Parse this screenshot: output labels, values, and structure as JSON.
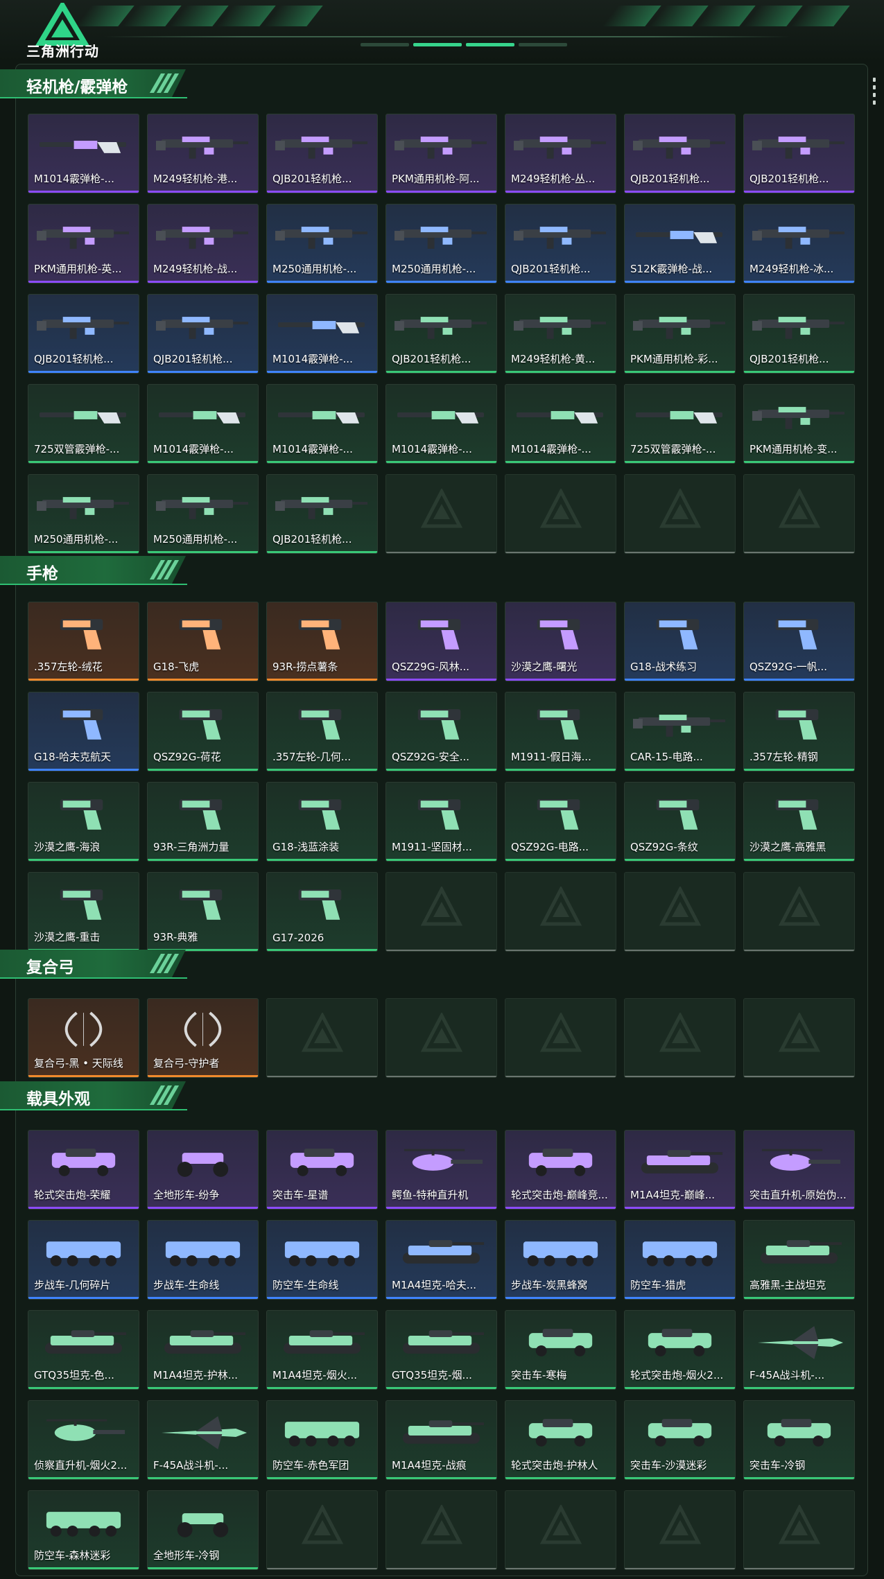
{
  "header": {
    "logo_text": "三角洲行动"
  },
  "colors": {
    "accent": "#37d58c",
    "purple": "#8c4bff",
    "blue": "#3f83ff",
    "green": "#39c877",
    "orange": "#f08a2c"
  },
  "sections": [
    {
      "title": "轻机枪/霰弹枪",
      "items": [
        {
          "name": "M1014霰弹枪-...",
          "rarity": "purple",
          "kind": "shotgun"
        },
        {
          "name": "M249轻机枪-港...",
          "rarity": "purple",
          "kind": "mg"
        },
        {
          "name": "QJB201轻机枪...",
          "rarity": "purple",
          "kind": "mg"
        },
        {
          "name": "PKM通用机枪-阿...",
          "rarity": "purple",
          "kind": "mg"
        },
        {
          "name": "M249轻机枪-丛...",
          "rarity": "purple",
          "kind": "mg"
        },
        {
          "name": "QJB201轻机枪...",
          "rarity": "purple",
          "kind": "mg"
        },
        {
          "name": "QJB201轻机枪...",
          "rarity": "purple",
          "kind": "mg"
        },
        {
          "name": "PKM通用机枪-英...",
          "rarity": "purple",
          "kind": "mg"
        },
        {
          "name": "M249轻机枪-战...",
          "rarity": "purple",
          "kind": "mg"
        },
        {
          "name": "M250通用机枪-...",
          "rarity": "blue",
          "kind": "mg"
        },
        {
          "name": "M250通用机枪-...",
          "rarity": "blue",
          "kind": "mg"
        },
        {
          "name": "QJB201轻机枪...",
          "rarity": "blue",
          "kind": "mg"
        },
        {
          "name": "S12K霰弹枪-战...",
          "rarity": "blue",
          "kind": "shotgun"
        },
        {
          "name": "M249轻机枪-冰...",
          "rarity": "blue",
          "kind": "mg"
        },
        {
          "name": "QJB201轻机枪...",
          "rarity": "blue",
          "kind": "mg"
        },
        {
          "name": "QJB201轻机枪...",
          "rarity": "blue",
          "kind": "mg"
        },
        {
          "name": "M1014霰弹枪-...",
          "rarity": "blue",
          "kind": "shotgun"
        },
        {
          "name": "QJB201轻机枪...",
          "rarity": "green",
          "kind": "mg"
        },
        {
          "name": "M249轻机枪-黄...",
          "rarity": "green",
          "kind": "mg"
        },
        {
          "name": "PKM通用机枪-彩...",
          "rarity": "green",
          "kind": "mg"
        },
        {
          "name": "QJB201轻机枪...",
          "rarity": "green",
          "kind": "mg"
        },
        {
          "name": "725双管霰弹枪-...",
          "rarity": "green",
          "kind": "shotgun"
        },
        {
          "name": "M1014霰弹枪-...",
          "rarity": "green",
          "kind": "shotgun"
        },
        {
          "name": "M1014霰弹枪-...",
          "rarity": "green",
          "kind": "shotgun"
        },
        {
          "name": "M1014霰弹枪-...",
          "rarity": "green",
          "kind": "shotgun"
        },
        {
          "name": "M1014霰弹枪-...",
          "rarity": "green",
          "kind": "shotgun"
        },
        {
          "name": "725双管霰弹枪-...",
          "rarity": "green",
          "kind": "shotgun"
        },
        {
          "name": "PKM通用机枪-变...",
          "rarity": "green",
          "kind": "mg"
        },
        {
          "name": "M250通用机枪-...",
          "rarity": "green",
          "kind": "mg"
        },
        {
          "name": "M250通用机枪-...",
          "rarity": "green",
          "kind": "mg"
        },
        {
          "name": "QJB201轻机枪...",
          "rarity": "green",
          "kind": "mg"
        }
      ]
    },
    {
      "title": "手枪",
      "items": [
        {
          "name": ".357左轮-绒花",
          "rarity": "orange",
          "kind": "pistol"
        },
        {
          "name": "G18-飞虎",
          "rarity": "orange",
          "kind": "pistol"
        },
        {
          "name": "93R-捞点薯条",
          "rarity": "orange",
          "kind": "pistol"
        },
        {
          "name": "QSZ29G-风林...",
          "rarity": "purple",
          "kind": "pistol"
        },
        {
          "name": "沙漠之鹰-曙光",
          "rarity": "purple",
          "kind": "pistol"
        },
        {
          "name": "G18-战术练习",
          "rarity": "blue",
          "kind": "pistol"
        },
        {
          "name": "QSZ92G-一帆...",
          "rarity": "blue",
          "kind": "pistol"
        },
        {
          "name": "G18-哈夫克航天",
          "rarity": "blue",
          "kind": "pistol"
        },
        {
          "name": "QSZ92G-荷花",
          "rarity": "green",
          "kind": "pistol"
        },
        {
          "name": ".357左轮-几何...",
          "rarity": "green",
          "kind": "pistol"
        },
        {
          "name": "QSZ92G-安全...",
          "rarity": "green",
          "kind": "pistol"
        },
        {
          "name": "M1911-假日海...",
          "rarity": "green",
          "kind": "pistol"
        },
        {
          "name": "CAR-15-电路...",
          "rarity": "green",
          "kind": "rifle"
        },
        {
          "name": ".357左轮-精钢",
          "rarity": "green",
          "kind": "pistol"
        },
        {
          "name": "沙漠之鹰-海浪",
          "rarity": "green",
          "kind": "pistol"
        },
        {
          "name": "93R-三角洲力量",
          "rarity": "green",
          "kind": "pistol"
        },
        {
          "name": "G18-浅蓝涂装",
          "rarity": "green",
          "kind": "pistol"
        },
        {
          "name": "M1911-坚固材...",
          "rarity": "green",
          "kind": "pistol"
        },
        {
          "name": "QSZ92G-电路...",
          "rarity": "green",
          "kind": "pistol"
        },
        {
          "name": "QSZ92G-条纹",
          "rarity": "green",
          "kind": "pistol"
        },
        {
          "name": "沙漠之鹰-高雅黑",
          "rarity": "green",
          "kind": "pistol"
        },
        {
          "name": "沙漠之鹰-重击",
          "rarity": "green",
          "kind": "pistol"
        },
        {
          "name": "93R-典雅",
          "rarity": "green",
          "kind": "pistol"
        },
        {
          "name": "G17-2026",
          "rarity": "green",
          "kind": "pistol"
        }
      ]
    },
    {
      "title": "复合弓",
      "items": [
        {
          "name": "复合弓-黑 • 天际线",
          "rarity": "orange",
          "kind": "bow"
        },
        {
          "name": "复合弓-守护者",
          "rarity": "orange",
          "kind": "bow"
        }
      ]
    },
    {
      "title": "载具外观",
      "items": [
        {
          "name": "轮式突击炮-荣耀",
          "rarity": "purple",
          "kind": "car"
        },
        {
          "name": "全地形车-纷争",
          "rarity": "purple",
          "kind": "atv"
        },
        {
          "name": "突击车-星谱",
          "rarity": "purple",
          "kind": "car"
        },
        {
          "name": "鳄鱼-特种直升机",
          "rarity": "purple",
          "kind": "heli"
        },
        {
          "name": "轮式突击炮-巅峰竞...",
          "rarity": "purple",
          "kind": "car"
        },
        {
          "name": "M1A4坦克-巅峰...",
          "rarity": "purple",
          "kind": "tank"
        },
        {
          "name": "突击直升机-原始伪...",
          "rarity": "purple",
          "kind": "heli"
        },
        {
          "name": "步战车-几何碎片",
          "rarity": "blue",
          "kind": "apc"
        },
        {
          "name": "步战车-生命线",
          "rarity": "blue",
          "kind": "apc"
        },
        {
          "name": "防空车-生命线",
          "rarity": "blue",
          "kind": "apc"
        },
        {
          "name": "M1A4坦克-哈夫...",
          "rarity": "blue",
          "kind": "tank"
        },
        {
          "name": "步战车-炭黑蜂窝",
          "rarity": "blue",
          "kind": "apc"
        },
        {
          "name": "防空车-猎虎",
          "rarity": "blue",
          "kind": "apc"
        },
        {
          "name": "高雅黑-主战坦克",
          "rarity": "green",
          "kind": "tank"
        },
        {
          "name": "GTQ35坦克-色...",
          "rarity": "green",
          "kind": "tank"
        },
        {
          "name": "M1A4坦克-护林...",
          "rarity": "green",
          "kind": "tank"
        },
        {
          "name": "M1A4坦克-烟火...",
          "rarity": "green",
          "kind": "tank"
        },
        {
          "name": "GTQ35坦克-烟...",
          "rarity": "green",
          "kind": "tank"
        },
        {
          "name": "突击车-寒梅",
          "rarity": "green",
          "kind": "car"
        },
        {
          "name": "轮式突击炮-烟火2...",
          "rarity": "green",
          "kind": "car"
        },
        {
          "name": "F-45A战斗机-...",
          "rarity": "green",
          "kind": "jet"
        },
        {
          "name": "侦察直升机-烟火2...",
          "rarity": "green",
          "kind": "heli"
        },
        {
          "name": "F-45A战斗机-...",
          "rarity": "green",
          "kind": "jet"
        },
        {
          "name": "防空车-赤色军团",
          "rarity": "green",
          "kind": "apc"
        },
        {
          "name": "M1A4坦克-战痕",
          "rarity": "green",
          "kind": "tank"
        },
        {
          "name": "轮式突击炮-护林人",
          "rarity": "green",
          "kind": "car"
        },
        {
          "name": "突击车-沙漠迷彩",
          "rarity": "green",
          "kind": "car"
        },
        {
          "name": "突击车-冷钢",
          "rarity": "green",
          "kind": "car"
        },
        {
          "name": "防空车-森林迷彩",
          "rarity": "green",
          "kind": "apc"
        },
        {
          "name": "全地形车-冷钢",
          "rarity": "green",
          "kind": "atv"
        }
      ]
    }
  ]
}
